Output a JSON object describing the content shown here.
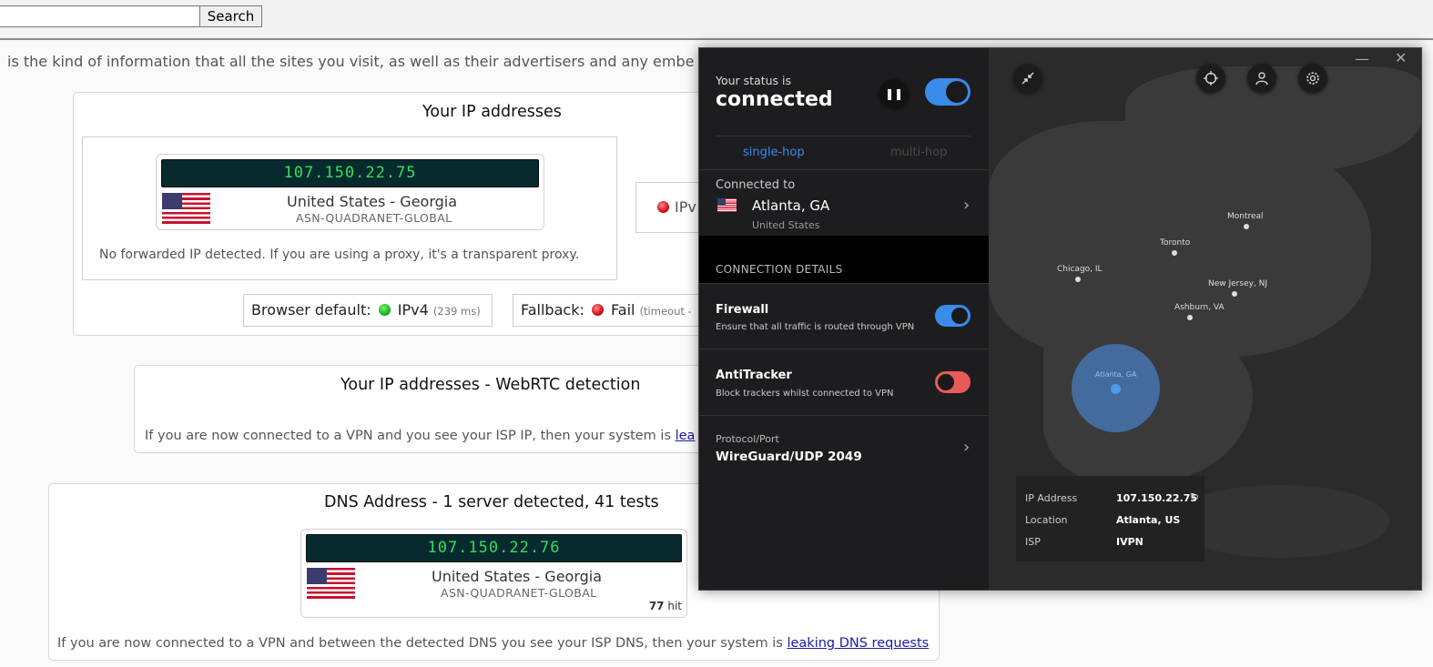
{
  "topbar": {
    "search_placeholder": "",
    "search_label": "Search"
  },
  "intro": "is the kind of information that all the sites you visit, as well as their advertisers and any embe",
  "ip_card": {
    "title": "Your IP addresses",
    "ip": "107.150.22.75",
    "country": "United States - Georgia",
    "asn": "ASN-QUADRANET-GLOBAL",
    "note": "No forwarded IP detected. If you are using a proxy, it's a transparent proxy.",
    "ipv6_label": "IPv",
    "browser_default_label": "Browser default:",
    "browser_default_value": "IPv4",
    "browser_default_ms": "(239 ms)",
    "fallback_label": "Fallback:",
    "fallback_value": "Fail",
    "fallback_detail": "(timeout -"
  },
  "webrtc_card": {
    "title": "Your IP addresses - WebRTC detection",
    "note": "If you are now connected to a VPN and you see your ISP IP, then your system is",
    "link": "lea"
  },
  "dns_card": {
    "title": "DNS Address - 1 server detected, 41 tests",
    "ip": "107.150.22.76",
    "country": "United States - Georgia",
    "asn": "ASN-QUADRANET-GLOBAL",
    "hits": "77",
    "hits_suffix": "hit",
    "note": "If you are now connected to a VPN and between the detected DNS you see your ISP DNS, then your system is",
    "link": "leaking DNS requests"
  },
  "vpn": {
    "status_label": "Your status is",
    "status_value": "connected",
    "hop_single": "single-hop",
    "hop_multi": "multi-hop",
    "connected_to_label": "Connected to",
    "city": "Atlanta, GA",
    "country": "United States",
    "details_label": "CONNECTION DETAILS",
    "firewall_title": "Firewall",
    "firewall_sub": "Ensure that all traffic is routed through VPN",
    "firewall_on": true,
    "antitracker_title": "AntiTracker",
    "antitracker_sub": "Block trackers whilst connected to VPN",
    "antitracker_on": false,
    "protocol_label": "Protocol/Port",
    "protocol_value": "WireGuard/UDP 2049",
    "colors": {
      "accent": "#3b8beb",
      "danger": "#e85a5a",
      "bubble": "#477ec4"
    }
  },
  "map": {
    "cities": [
      "Montreal",
      "Toronto",
      "Chicago, IL",
      "New Jersey, NJ",
      "Ashburn, VA"
    ],
    "bubble_label": "Atlanta, GA",
    "info": {
      "ip_label": "IP Address",
      "ip_value": "107.150.22.75",
      "location_label": "Location",
      "location_value": "Atlanta, US",
      "isp_label": "ISP",
      "isp_value": "IVPN"
    }
  }
}
